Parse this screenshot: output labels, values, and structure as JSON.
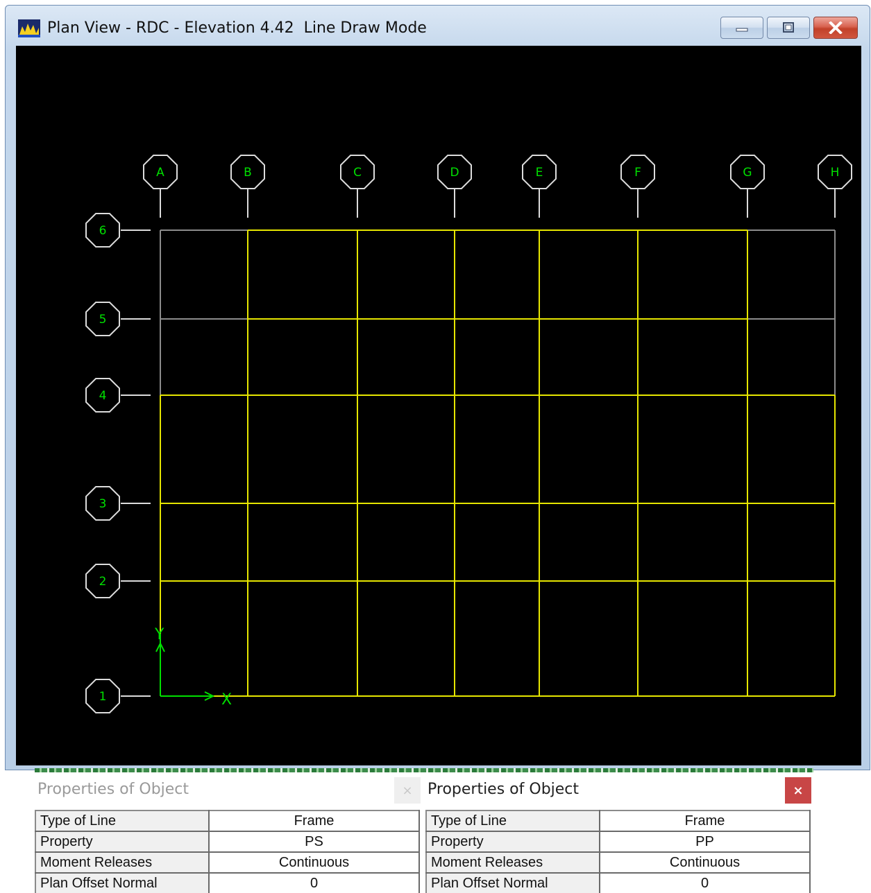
{
  "window": {
    "title": "Plan View - RDC - Elevation 4.42  Line Draw Mode",
    "controls": {
      "minimize_icon": "minimize-icon",
      "maximize_icon": "maximize-icon",
      "close_icon": "close-icon"
    }
  },
  "plan": {
    "grid_x": [
      "A",
      "B",
      "C",
      "D",
      "E",
      "F",
      "G",
      "H"
    ],
    "grid_y": [
      "6",
      "5",
      "4",
      "3",
      "2",
      "1"
    ],
    "axis_x_label": "X",
    "axis_y_label": "Y",
    "colors": {
      "background": "#000000",
      "bubbles": "#dcdcdc",
      "labels": "#00e000",
      "frames": "#e6e600",
      "unassigned_lines": "#8c8c8c",
      "axes": "#00e000"
    }
  },
  "properties_left": {
    "title": "Properties of Object",
    "close_label": "×",
    "rows": [
      {
        "key": "Type of Line",
        "value": "Frame"
      },
      {
        "key": "Property",
        "value": "PS"
      },
      {
        "key": "Moment Releases",
        "value": "Continuous"
      },
      {
        "key": "Plan Offset Normal",
        "value": "0"
      }
    ]
  },
  "properties_right": {
    "title": "Properties of Object",
    "close_label": "×",
    "rows": [
      {
        "key": "Type of Line",
        "value": "Frame"
      },
      {
        "key": "Property",
        "value": "PP"
      },
      {
        "key": "Moment Releases",
        "value": "Continuous"
      },
      {
        "key": "Plan Offset Normal",
        "value": "0"
      }
    ]
  }
}
